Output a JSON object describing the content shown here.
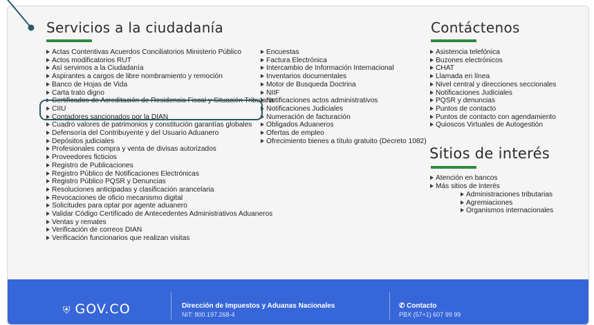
{
  "servicios": {
    "title": "Servicios a la ciudadanía",
    "col1": [
      "Actas Contentivas Acuerdos Conciliatorios Ministerio Público",
      "Actos modificatorios RUT",
      "Así servimos a la Ciudadanía",
      "Aspirantes a cargos de libre nombramiento y remoción",
      "Banco de Hojas de Vida",
      "Carta trato digno",
      "Certificados de Acreditación de Residencia Fiscal y Situación Tributaria",
      "CIIU",
      "Contadores sancionados por la DIAN",
      "Cuadro valores de patrimonios y constitución garantías globales",
      "Defensoría del Contribuyente y del Usuario Aduanero",
      "Depósitos judiciales",
      "Profesionales compra y venta de divisas autorizados",
      "Proveedores ficticios",
      "Registro de Publicaciones",
      "Registro Público de Notificaciones Electrónicas",
      "Registro Público PQSR y Denuncias",
      "Resoluciones anticipadas y clasificación arancelaria",
      "Revocaciones de oficio mecanismo digital",
      "Solicitudes para optar por agente aduanero",
      "Validar Código Certificado de Antecedentes Administrativos Aduaneros",
      "Ventas y remates",
      "Verificación de correos DIAN",
      "Verificación funcionarios que realizan visitas"
    ],
    "col2": [
      "Encuestas",
      "Factura Electrónica",
      "Intercambio de Información Internacional",
      "Inventarios documentales",
      "Motor de Busqueda Doctrina",
      "NIIF",
      "Notificaciones actos administrativos",
      "Notificaciones Judiciales",
      "Numeración de facturación",
      "Obligados Aduaneros",
      "Ofertas de empleo",
      "Ofrecimiento bienes a título gratuito (Decreto 1082)"
    ]
  },
  "contactenos": {
    "title": "Contáctenos",
    "items": [
      "Asistencia telefónica",
      "Buzones electrónicos",
      "CHAT",
      "Llamada en línea",
      "Nivel central y direcciones seccionales",
      "Notificaciones Judiciales",
      "PQSR y denuncias",
      "Puntos de contacto",
      "Puntos de contacto con agendamiento",
      "Quioscos Virtuales de Autogestión"
    ]
  },
  "sitios": {
    "title": "Sitios de interés",
    "items": [
      "Atención en bancos",
      "Más sitios de interés"
    ],
    "subitems": [
      "Administraciones tributarias",
      "Agremiaciones",
      "Organismos internacionales"
    ]
  },
  "footer": {
    "logo": "GOV.CO",
    "entity": "Dirección de Impuestos y Aduanas Nacionales",
    "nit": "NIT: 800.197.268-4",
    "contact_title": "Contacto",
    "pbx": "PBX (57+1) 607 99 99"
  },
  "colors": {
    "accent_green": "#2e8b3e",
    "footer_blue": "#3766d8",
    "highlight": "#2a5a6a"
  }
}
